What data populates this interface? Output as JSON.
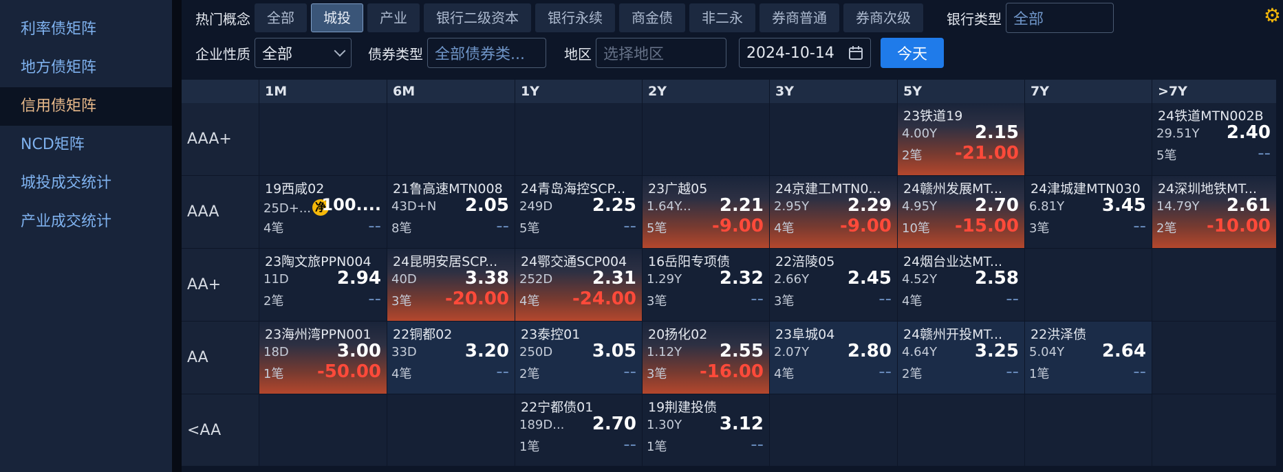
{
  "sidebar": {
    "items": [
      {
        "label": "利率债矩阵",
        "active": false
      },
      {
        "label": "地方债矩阵",
        "active": false
      },
      {
        "label": "信用债矩阵",
        "active": true
      },
      {
        "label": "NCD矩阵",
        "active": false
      },
      {
        "label": "城投成交统计",
        "active": false
      },
      {
        "label": "产业成交统计",
        "active": false
      }
    ]
  },
  "filters": {
    "hot_label": "热门概念",
    "hot_tags": [
      "全部",
      "城投",
      "产业",
      "银行二级资本",
      "银行永续",
      "商金债",
      "非二永",
      "券商普通",
      "券商次级"
    ],
    "hot_active": "城投",
    "bank_type_label": "银行类型",
    "bank_type_value": "全部",
    "enterprise_label": "企业性质",
    "enterprise_value": "全部",
    "bond_type_label": "债券类型",
    "bond_type_placeholder": "全部债券类...",
    "region_label": "地区",
    "region_placeholder": "选择地区",
    "date_value": "2024-10-14",
    "today_label": "今天",
    "settings_icon": "gear-icon"
  },
  "grid": {
    "columns": [
      "1M",
      "6M",
      "1Y",
      "2Y",
      "3Y",
      "5Y",
      "7Y",
      ">7Y"
    ],
    "rows": [
      {
        "label": "AAA+",
        "cells": [
          null,
          null,
          null,
          null,
          null,
          {
            "name": "23铁道19",
            "term": "4.00Y",
            "rate": "2.15",
            "count": "2笔",
            "change": "-21.00",
            "neg": true
          },
          null,
          {
            "name": "24铁道MTN002B",
            "term": "29.51Y",
            "rate": "2.40",
            "count": "5笔",
            "change": "--"
          }
        ]
      },
      {
        "label": "AAA",
        "cells": [
          {
            "name": "19西咸02",
            "term": "25D+...",
            "badge": "净",
            "rate": "100....",
            "count": "4笔",
            "change": "--"
          },
          {
            "name": "21鲁高速MTN008",
            "term": "43D+N",
            "rate": "2.05",
            "count": "8笔",
            "change": "--"
          },
          {
            "name": "24青岛海控SCP...",
            "term": "249D",
            "rate": "2.25",
            "count": "5笔",
            "change": "--"
          },
          {
            "name": "23广越05",
            "term": "1.64Y...",
            "rate": "2.21",
            "count": "5笔",
            "change": "-9.00",
            "neg": true
          },
          {
            "name": "24京建工MTN0...",
            "term": "2.95Y",
            "rate": "2.29",
            "count": "4笔",
            "change": "-9.00",
            "neg": true
          },
          {
            "name": "24赣州发展MT...",
            "term": "4.95Y",
            "rate": "2.70",
            "count": "10笔",
            "change": "-15.00",
            "neg": true
          },
          {
            "name": "24津城建MTN030",
            "term": "6.81Y",
            "rate": "3.45",
            "count": "3笔",
            "change": "--"
          },
          {
            "name": "24深圳地铁MT...",
            "term": "14.79Y",
            "rate": "2.61",
            "count": "2笔",
            "change": "-10.00",
            "neg": true
          }
        ]
      },
      {
        "label": "AA+",
        "cells": [
          {
            "name": "23陶文旅PPN004",
            "term": "11D",
            "rate": "2.94",
            "count": "2笔",
            "change": "--"
          },
          {
            "name": "24昆明安居SCP...",
            "term": "40D",
            "rate": "3.38",
            "count": "3笔",
            "change": "-20.00",
            "neg": true
          },
          {
            "name": "24鄂交通SCP004",
            "term": "252D",
            "rate": "2.31",
            "count": "4笔",
            "change": "-24.00",
            "neg": true
          },
          {
            "name": "16岳阳专项债",
            "term": "1.29Y",
            "rate": "2.32",
            "count": "3笔",
            "change": "--"
          },
          {
            "name": "22涪陵05",
            "term": "2.66Y",
            "rate": "2.45",
            "count": "3笔",
            "change": "--"
          },
          {
            "name": "24烟台业达MT...",
            "term": "4.52Y",
            "rate": "2.58",
            "count": "4笔",
            "change": "--"
          },
          null,
          null
        ]
      },
      {
        "label": "AA",
        "cells": [
          {
            "name": "23海州湾PPN001",
            "term": "18D",
            "rate": "3.00",
            "count": "1笔",
            "change": "-50.00",
            "neg": true
          },
          {
            "name": "22铜都02",
            "term": "33D",
            "rate": "3.20",
            "count": "4笔",
            "change": "--"
          },
          {
            "name": "23泰控01",
            "term": "250D",
            "rate": "3.05",
            "count": "2笔",
            "change": "--"
          },
          {
            "name": "20扬化02",
            "term": "1.12Y",
            "rate": "2.55",
            "count": "3笔",
            "change": "-16.00",
            "neg": true
          },
          {
            "name": "23阜城04",
            "term": "2.07Y",
            "rate": "2.80",
            "count": "4笔",
            "change": "--"
          },
          {
            "name": "24赣州开投MT...",
            "term": "4.64Y",
            "rate": "3.25",
            "count": "2笔",
            "change": "--"
          },
          {
            "name": "22洪泽债",
            "term": "5.04Y",
            "rate": "2.64",
            "count": "1笔",
            "change": "--"
          },
          null
        ]
      },
      {
        "label": "<AA",
        "cells": [
          null,
          null,
          {
            "name": "22宁都债01",
            "term": "189D...",
            "rate": "2.70",
            "count": "1笔",
            "change": "--"
          },
          {
            "name": "19荆建投债",
            "term": "1.30Y",
            "rate": "3.12",
            "count": "1笔",
            "change": "--"
          },
          null,
          null,
          null,
          null
        ]
      }
    ]
  }
}
